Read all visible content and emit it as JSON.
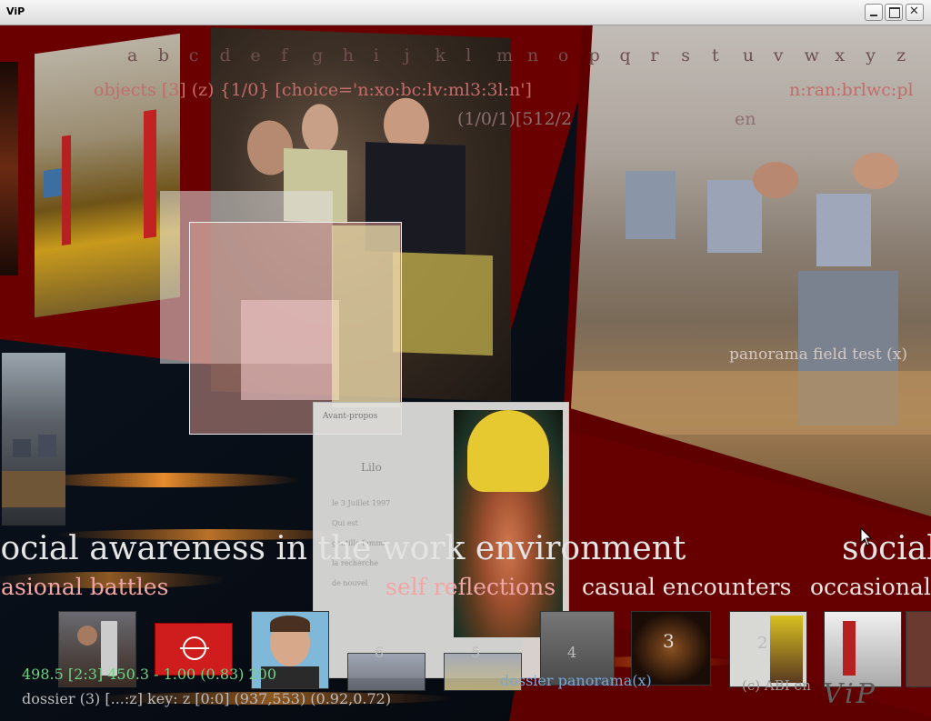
{
  "window": {
    "title": "ViP",
    "controls": [
      "minimize",
      "maximize",
      "close"
    ]
  },
  "alphabet": [
    "a",
    "b",
    "c",
    "d",
    "e",
    "f",
    "g",
    "h",
    "i",
    "j",
    "k",
    "l",
    "m",
    "n",
    "o",
    "p",
    "q",
    "r",
    "s",
    "t",
    "u",
    "v",
    "w",
    "x",
    "y",
    "z"
  ],
  "overlay": {
    "objects_line": "objects [3] (z) {1/0} [choice='n:xo:bc:lv:ml3:3l:n']",
    "objects_line_right": "n:ran:brlwc:pl",
    "counter_line": "(1/0/1)[512/2",
    "counter_suffix": "en"
  },
  "panels": {
    "panorama_label": "panorama field test (x)",
    "document_card": {
      "header": "Avant-propos",
      "name": "Lilo",
      "body_lines": [
        "le 3 Juillet 1997",
        "Qui est",
        "gentille femme",
        "la recherche",
        "de nouvel"
      ]
    }
  },
  "ticker": {
    "main": "social awareness in the work environment",
    "main_repeat": "social",
    "themes": [
      "occasional battles",
      "self reflections",
      "casual encounters",
      "occasional"
    ]
  },
  "thumbnails": {
    "numbers": [
      "6",
      "5",
      "4",
      "3",
      "2"
    ]
  },
  "status": {
    "line1": "498.5 [2:3] 450.3 - 1.00 (0.83) 200",
    "line2": "dossier (3) [...:z] key: z [0:0] (937,553) (0.92,0.72)",
    "dossier_link": "dossier panorama(x)",
    "copyright": "(c) ABI en",
    "logo": "ViP"
  },
  "colors": {
    "maroon": "#6b0000",
    "pink": "#f1a5a5",
    "light": "#e7e7e7",
    "green": "#6fd488",
    "blue": "#7aa6d6"
  }
}
